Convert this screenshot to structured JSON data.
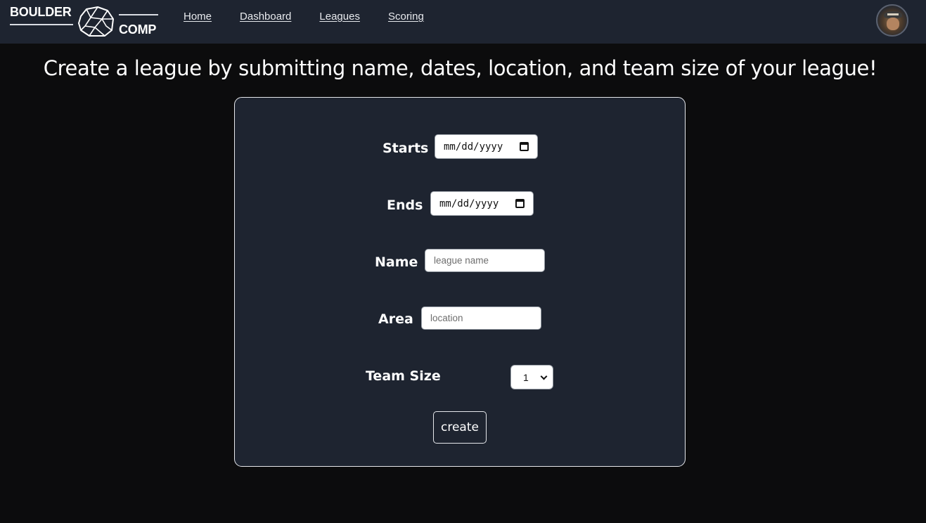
{
  "brand": {
    "line1": "BOULDER",
    "line2": "COMP"
  },
  "nav": {
    "links": [
      "Home",
      "Dashboard",
      "Leagues",
      "Scoring"
    ]
  },
  "page_title": "Create a league by submitting name, dates, location, and team size of your league!",
  "form": {
    "starts_label": "Starts",
    "starts_value": "mm/dd/yyyy",
    "ends_label": "Ends",
    "ends_value": "mm/dd/yyyy",
    "name_label": "Name",
    "name_placeholder": "league name",
    "area_label": "Area",
    "area_placeholder": "location",
    "team_size_label": "Team Size",
    "team_size_value": "1",
    "create_label": "create"
  },
  "colors": {
    "background": "#0c0c0d",
    "navbar": "#1e2430",
    "card": "#1e2430",
    "border": "#e6e8ec"
  },
  "icons": [
    "rock-logo-icon",
    "calendar-icon",
    "chevron-down-icon",
    "user-avatar"
  ]
}
